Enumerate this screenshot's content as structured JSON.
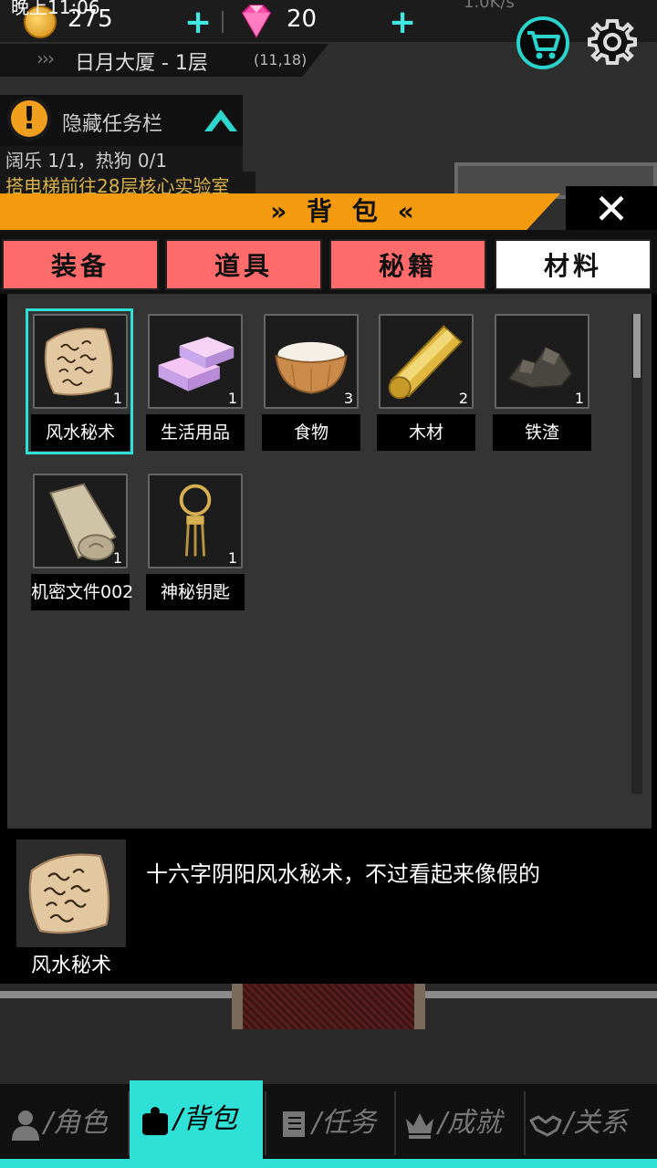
{
  "status_bar": {
    "time": "晚上11:06",
    "net_speed": "1.0K/s"
  },
  "hud": {
    "coins": "275",
    "gems": "20",
    "location": "日月大厦 - 1层",
    "coords": "(11,18)",
    "accent_color": "#2fe0d6"
  },
  "tasks": {
    "hide_label": "隐藏任务栏",
    "line1": "阔乐 1/1，热狗 0/1",
    "line2": "搭电梯前往28层核心实验室"
  },
  "bag": {
    "title": "»   背 包   «",
    "close_label": "✕",
    "tabs": [
      {
        "label": "装备",
        "active": false
      },
      {
        "label": "道具",
        "active": false
      },
      {
        "label": "秘籍",
        "active": false
      },
      {
        "label": "材料",
        "active": true
      }
    ],
    "items": [
      {
        "name": "风水秘术",
        "count": "1",
        "icon": "scroll-parchment-icon",
        "selected": true
      },
      {
        "name": "生活用品",
        "count": "1",
        "icon": "soap-bars-icon",
        "selected": false
      },
      {
        "name": "食物",
        "count": "3",
        "icon": "rice-bowl-icon",
        "selected": false
      },
      {
        "name": "木材",
        "count": "2",
        "icon": "wood-log-icon",
        "selected": false
      },
      {
        "name": "铁渣",
        "count": "1",
        "icon": "iron-slag-icon",
        "selected": false
      },
      {
        "name": "机密文件002",
        "count": "1",
        "icon": "rolled-document-icon",
        "selected": false
      },
      {
        "name": "神秘钥匙",
        "count": "1",
        "icon": "mystic-key-ring-icon",
        "selected": false
      }
    ],
    "detail": {
      "name": "风水秘术",
      "description": "十六字阴阳风水秘术，不过看起来像假的"
    }
  },
  "nav": [
    {
      "label": "/角色",
      "icon": "person-icon",
      "active": false
    },
    {
      "label": "/背包",
      "icon": "bag-icon",
      "active": true
    },
    {
      "label": "/任务",
      "icon": "book-icon",
      "active": false
    },
    {
      "label": "/成就",
      "icon": "crown-icon",
      "active": false
    },
    {
      "label": "/关系",
      "icon": "handshake-icon",
      "active": false
    }
  ]
}
